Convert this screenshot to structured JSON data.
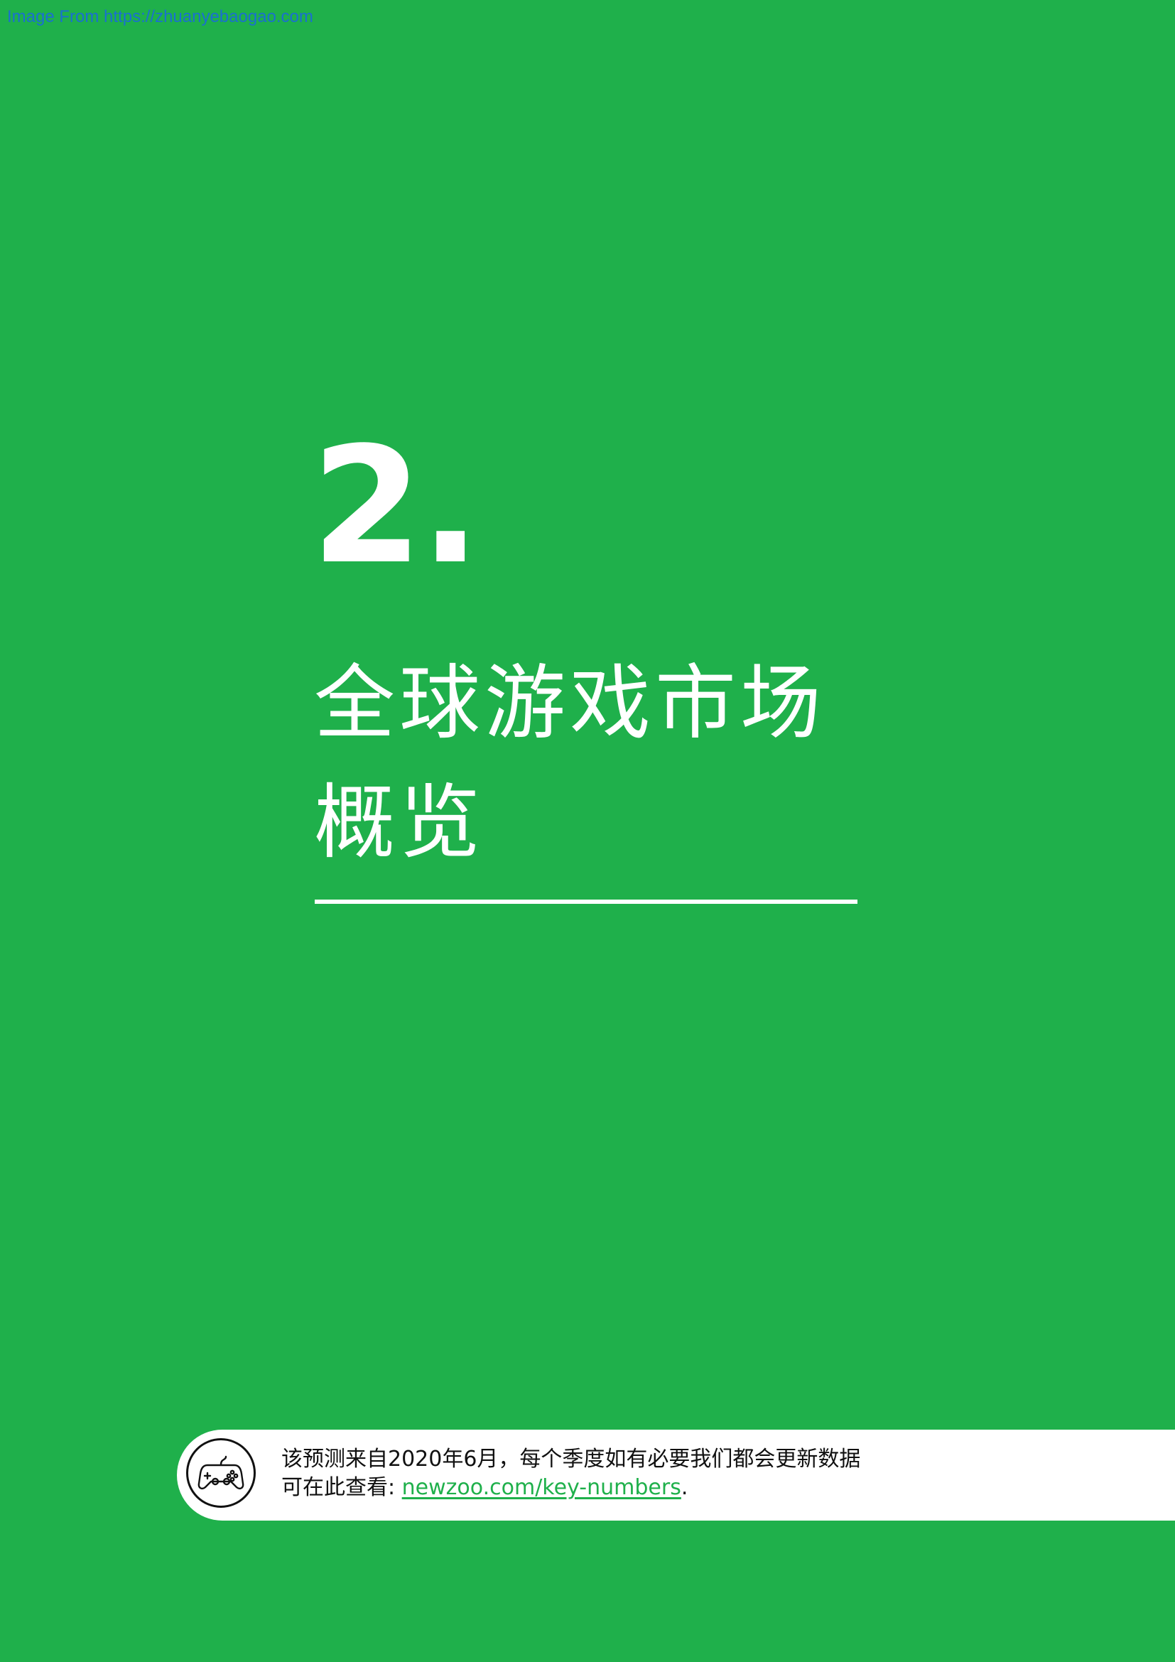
{
  "watermark": "Image From https://zhuanyebaogao.com",
  "section": {
    "number": "2.",
    "title_line1": "全球游戏市场",
    "title_line2": "概览"
  },
  "info_bar": {
    "icon": "game-controller-icon",
    "line1": "该预测来自2020年6月，每个季度如有必要我们都会更新数据",
    "line2_prefix": "可在此查看: ",
    "link_text": "newzoo.com/key-numbers",
    "line2_suffix": "."
  },
  "colors": {
    "background": "#1fb04b",
    "text_primary": "#ffffff",
    "link": "#1fb04b",
    "watermark": "#1a6fd1"
  }
}
